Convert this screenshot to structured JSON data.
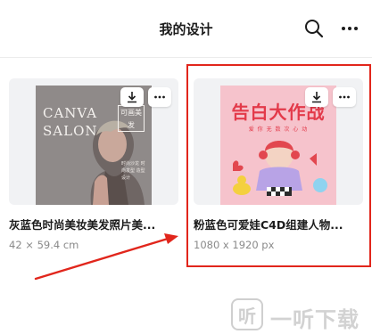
{
  "header": {
    "title": "我的设计",
    "search_icon": "search-icon",
    "more_icon": "more-horizontal-icon"
  },
  "designs": [
    {
      "title": "灰蓝色时尚美妆美发照片美...",
      "size": "42 × 59.4 cm",
      "poster": {
        "line1": "CANVA",
        "line2": "SALON",
        "badge": "可画美发",
        "caption": "时尚沙龙 时尚发型 造型设计"
      }
    },
    {
      "title": "粉蓝色可爱娃C4D组建人物...",
      "size": "1080 x 1920 px",
      "poster": {
        "headline": "告白大作战",
        "caption": "爱 你 无 数 次 心 动"
      }
    }
  ],
  "watermark": {
    "box_char": "听",
    "text": "一听下载"
  },
  "colors": {
    "annotation_red": "#e1261c",
    "left_poster": "#8f8a89",
    "right_poster": "#f6c3cc"
  }
}
